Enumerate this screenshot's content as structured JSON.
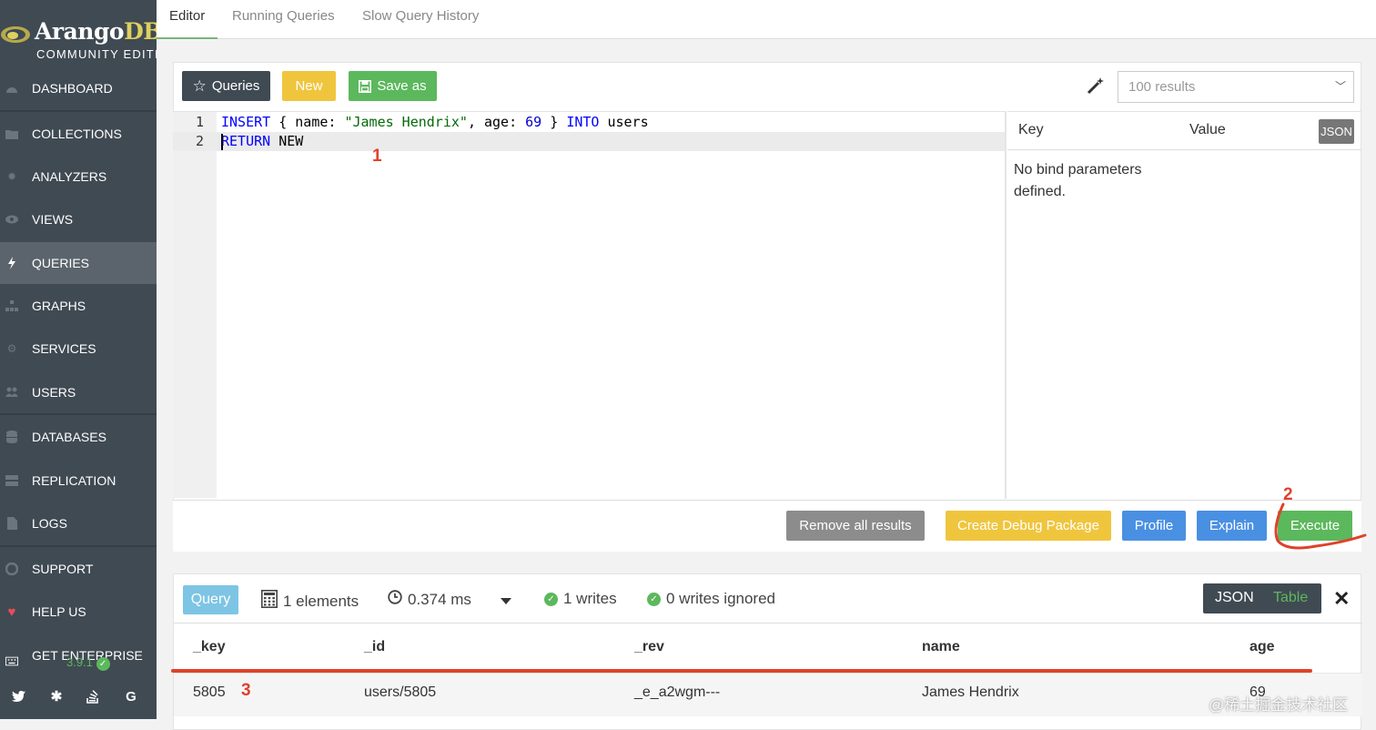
{
  "app": {
    "logo_main": "Arango",
    "logo_accent": "DB",
    "edition": "COMMUNITY EDITION",
    "version": "3.9.1"
  },
  "sidebar": {
    "items": [
      {
        "label": "DASHBOARD",
        "icon": "dashboard-icon"
      },
      {
        "label": "COLLECTIONS",
        "icon": "folder-icon"
      },
      {
        "label": "ANALYZERS",
        "icon": "gear-icon"
      },
      {
        "label": "VIEWS",
        "icon": "eye-icon"
      },
      {
        "label": "QUERIES",
        "icon": "bolt-icon",
        "active": true
      },
      {
        "label": "GRAPHS",
        "icon": "sitemap-icon"
      },
      {
        "label": "SERVICES",
        "icon": "cogs-icon"
      },
      {
        "label": "USERS",
        "icon": "users-icon"
      },
      {
        "label": "DATABASES",
        "icon": "database-icon"
      },
      {
        "label": "REPLICATION",
        "icon": "server-icon"
      },
      {
        "label": "LOGS",
        "icon": "file-icon"
      },
      {
        "label": "SUPPORT",
        "icon": "lifebuoy-icon"
      },
      {
        "label": "HELP US",
        "icon": "heart-icon"
      },
      {
        "label": "GET ENTERPRISE",
        "icon": "keyboard-icon"
      }
    ],
    "social": [
      "twitter-icon",
      "slack-icon",
      "stackoverflow-icon",
      "google-icon"
    ]
  },
  "tabs": [
    "Editor",
    "Running Queries",
    "Slow Query History"
  ],
  "toolbar": {
    "queries_label": "Queries",
    "new_label": "New",
    "save_as_label": "Save as",
    "results_select": "100 results"
  },
  "editor": {
    "line_numbers": [
      "1",
      "2"
    ],
    "lines": [
      [
        {
          "t": "INSERT",
          "c": "kw"
        },
        {
          "t": " { name: ",
          "c": ""
        },
        {
          "t": "\"James Hendrix\"",
          "c": "str"
        },
        {
          "t": ", age: ",
          "c": ""
        },
        {
          "t": "69",
          "c": "num"
        },
        {
          "t": " } ",
          "c": ""
        },
        {
          "t": "INTO",
          "c": "kw"
        },
        {
          "t": " users",
          "c": ""
        }
      ],
      [
        {
          "t": "RETURN",
          "c": "kw"
        },
        {
          "t": " NEW",
          "c": ""
        }
      ]
    ]
  },
  "bind": {
    "key_header": "Key",
    "value_header": "Value",
    "json_label": "JSON",
    "empty_text": "No bind parameters defined."
  },
  "actions": {
    "remove_all": "Remove all results",
    "debug": "Create Debug Package",
    "profile": "Profile",
    "explain": "Explain",
    "execute": "Execute"
  },
  "results": {
    "badge": "Query",
    "elements": "1 elements",
    "time": "0.374 ms",
    "writes": "1 writes",
    "writes_ignored": "0 writes ignored",
    "json_label": "JSON",
    "table_label": "Table",
    "columns": [
      "_key",
      "_id",
      "_rev",
      "name",
      "age"
    ],
    "rows": [
      [
        "5805",
        "users/5805",
        "_e_a2wgm---",
        "James Hendrix",
        "69"
      ]
    ]
  },
  "annotations": [
    "1",
    "2",
    "3"
  ],
  "watermark": "@稀土掘金技术社区",
  "colors": {
    "sidebar": "#404a53",
    "active_nav": "#5b646c",
    "green": "#5cb85c",
    "yellow": "#f0c53e",
    "blue": "#4a90e2",
    "annotation_red": "#e0412a"
  }
}
